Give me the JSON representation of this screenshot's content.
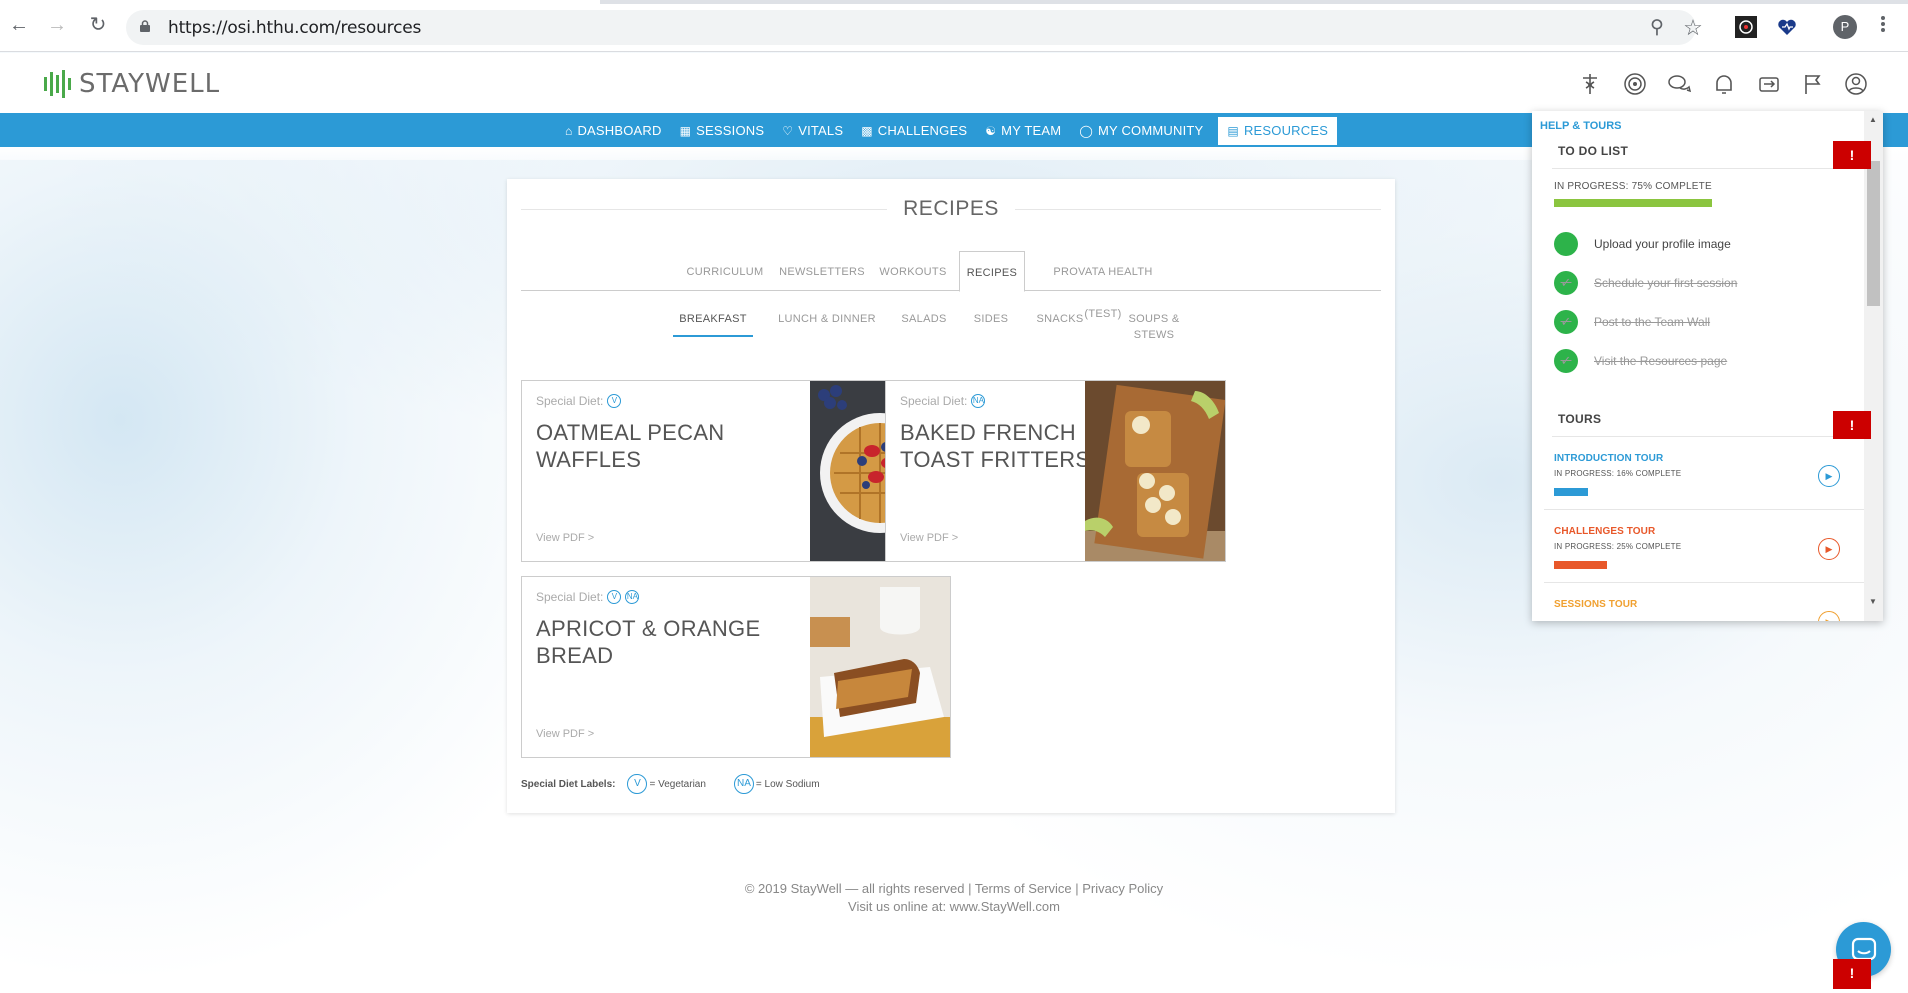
{
  "browser": {
    "url": "https://osi.hthu.com/resources",
    "profile_initial": "P"
  },
  "brand": {
    "name": "STAYWELL",
    "accent": "#2c9ad6",
    "green": "#4aa94a"
  },
  "nav": [
    {
      "label": "DASHBOARD",
      "icon": "home-icon"
    },
    {
      "label": "SESSIONS",
      "icon": "calendar-icon"
    },
    {
      "label": "VITALS",
      "icon": "heart-icon"
    },
    {
      "label": "CHALLENGES",
      "icon": "chart-icon"
    },
    {
      "label": "MY TEAM",
      "icon": "team-icon"
    },
    {
      "label": "MY COMMUNITY",
      "icon": "globe-icon"
    },
    {
      "label": "RESOURCES",
      "icon": "resources-icon",
      "active": true
    }
  ],
  "page": {
    "title": "RECIPES",
    "tabs": [
      "CURRICULUM",
      "NEWSLETTERS",
      "WORKOUTS",
      "RECIPES",
      "PROVATA HEALTH (TEST)"
    ],
    "subtabs": [
      "BREAKFAST",
      "LUNCH & DINNER",
      "SALADS",
      "SIDES",
      "SNACKS",
      "SOUPS & STEWS"
    ],
    "recipes": [
      {
        "diet_label": "Special Diet:",
        "badges": [
          "V"
        ],
        "title": "OATMEAL PECAN WAFFLES",
        "link": "View PDF >"
      },
      {
        "diet_label": "Special Diet:",
        "badges": [
          "NA"
        ],
        "title": "BAKED FRENCH TOAST FRITTERS",
        "link": "View PDF >"
      },
      {
        "diet_label": "Special Diet:",
        "badges": [
          "V",
          "NA"
        ],
        "title": "APRICOT & ORANGE BREAD",
        "link": "View PDF >"
      }
    ],
    "legend": {
      "label": "Special Diet Labels:",
      "v": "V",
      "v_text": "= Vegetarian",
      "na": "NA",
      "na_text": "= Low Sodium"
    }
  },
  "footer": {
    "line1": "© 2019 StayWell — all rights reserved | Terms of Service | Privacy Policy",
    "line2": "Visit us online at: www.StayWell.com"
  },
  "help": {
    "header": "HELP & TOURS",
    "todo_title": "TO DO LIST",
    "todo_progress": "IN PROGRESS: 75% COMPLETE",
    "todo_progress_value": 0.75,
    "todos": [
      {
        "label": "Upload your profile image",
        "done": false
      },
      {
        "label": "Schedule your first session",
        "done": true
      },
      {
        "label": "Post to the Team Wall",
        "done": true
      },
      {
        "label": "Visit the Resources page",
        "done": true
      }
    ],
    "tours_title": "TOURS",
    "tours": [
      {
        "name": "INTRODUCTION TOUR",
        "progress": "IN PROGRESS: 16% COMPLETE",
        "value": 0.16,
        "color": "#2c9ad6"
      },
      {
        "name": "CHALLENGES TOUR",
        "progress": "IN PROGRESS: 25% COMPLETE",
        "value": 0.25,
        "color": "#e8582a"
      },
      {
        "name": "SESSIONS TOUR",
        "color": "#f0a030"
      }
    ],
    "alert": "!"
  }
}
